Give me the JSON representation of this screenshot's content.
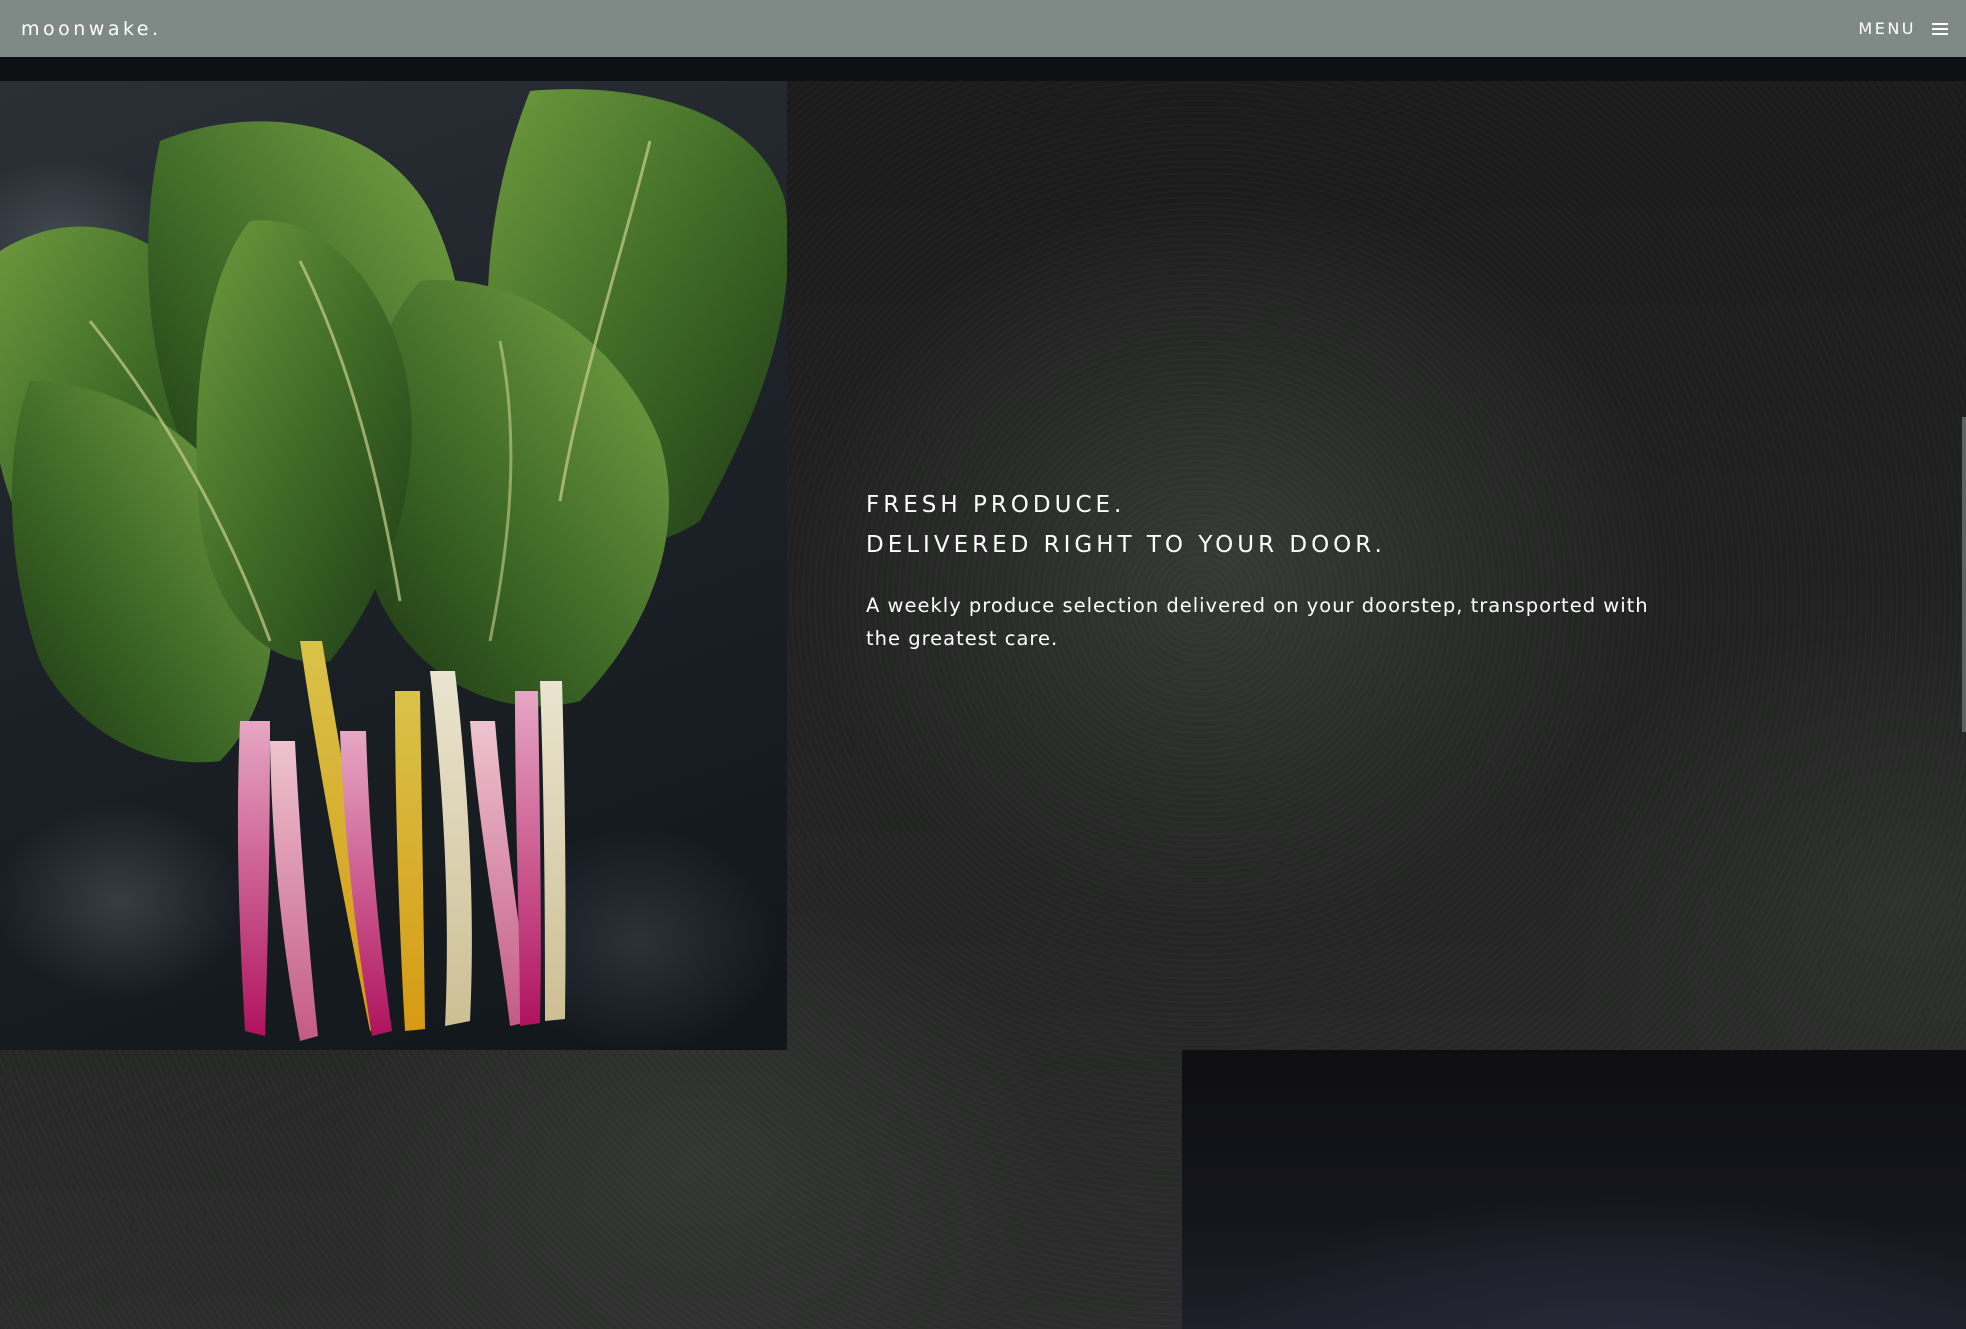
{
  "header": {
    "logo": "moonwake.",
    "menu_label": "MENU",
    "menu_icon": "hamburger-icon",
    "background_color": "#7f8a87"
  },
  "hero": {
    "heading_line_1": "FRESH PRODUCE.",
    "heading_line_2": "DELIVERED RIGHT TO YOUR DOOR.",
    "description": "A weekly produce selection delivered on your doorstep, transported with the greatest care."
  },
  "colors": {
    "text": "#ffffff",
    "page_background": "#1b1c1b"
  }
}
